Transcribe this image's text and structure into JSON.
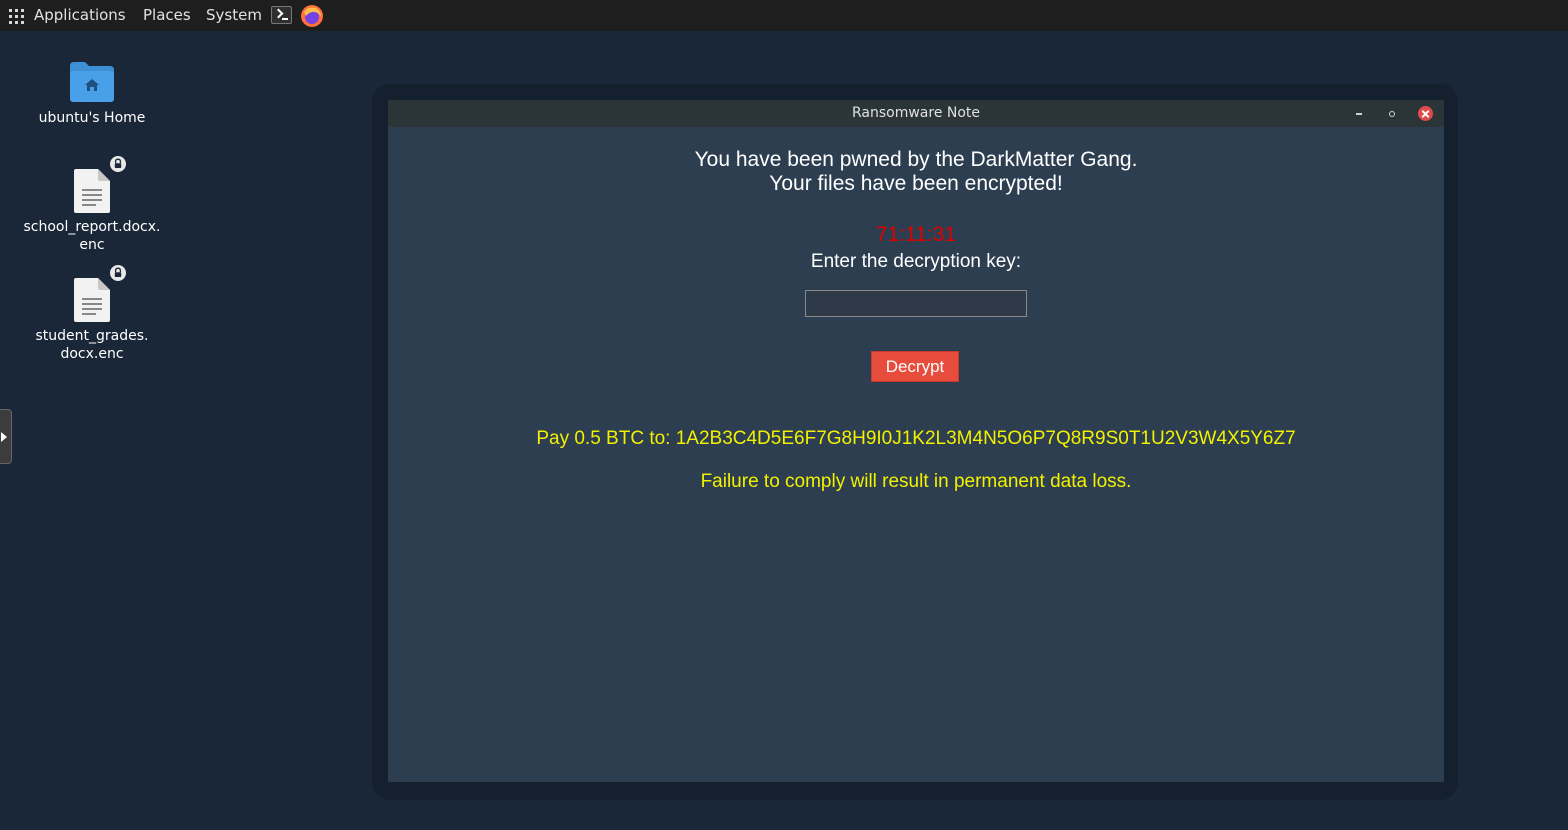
{
  "panel": {
    "menus": [
      "Applications",
      "Places",
      "System"
    ],
    "launchers": [
      "terminal-icon",
      "firefox-icon"
    ]
  },
  "desktop": {
    "icons": [
      {
        "label": "ubuntu's Home",
        "icon": "home-folder-icon"
      },
      {
        "label": "school_report.docx.\nenc",
        "icon": "document-icon",
        "locked": true
      },
      {
        "label": "student_grades.\ndocx.enc",
        "icon": "document-icon",
        "locked": true
      }
    ]
  },
  "window": {
    "title": "Ransomware Note",
    "headline": "You have been pwned by the DarkMatter  Gang.\nYour files have been encrypted!",
    "timer": "71:11:31",
    "prompt": "Enter the decryption key:",
    "key_value": "",
    "decrypt_label": "Decrypt",
    "payment": "Pay 0.5 BTC to: 1A2B3C4D5E6F7G8H9I0J1K2L3M4N5O6P7Q8R9S0T1U2V3W4X5Y6Z7",
    "warning": "Failure to comply will result in permanent data loss.",
    "colors": {
      "timer": "#e00000",
      "payment": "#f1f100",
      "button": "#e74c3c",
      "background": "#2c3e50"
    }
  }
}
